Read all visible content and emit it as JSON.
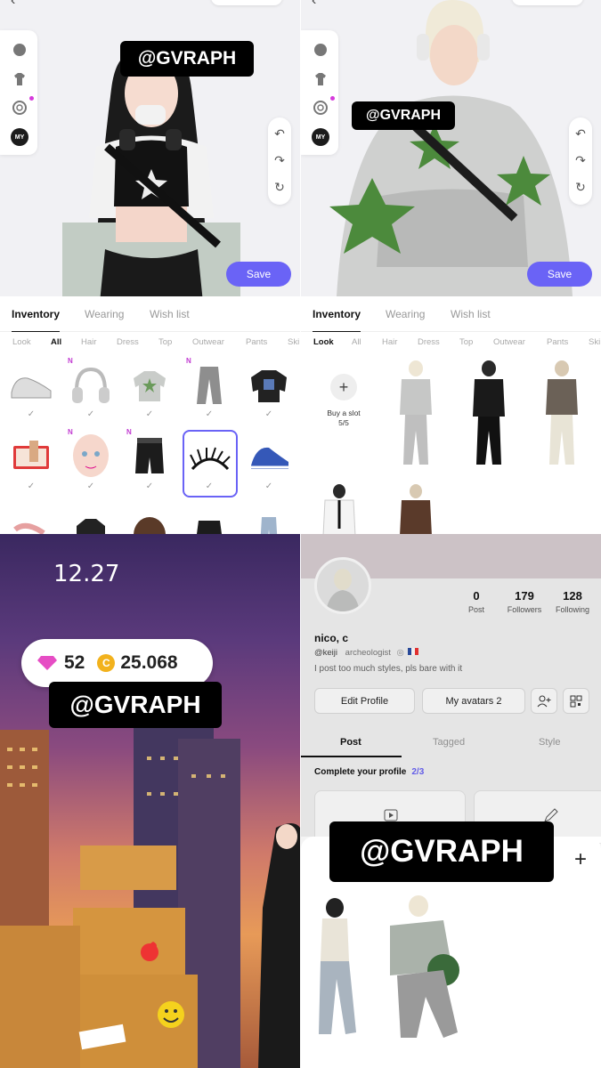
{
  "watermark": "@GVRAPH",
  "editor": {
    "save_label": "Save",
    "rail": [
      "head-icon",
      "shirt-icon",
      "coin-icon",
      "my-icon"
    ],
    "rail_my_label": "MY",
    "tabs": [
      "Inventory",
      "Wearing",
      "Wish list"
    ]
  },
  "left_panel": {
    "categories": [
      "Look",
      "All",
      "Hair",
      "Dress",
      "Top",
      "Outwear",
      "Pants",
      "Ski"
    ],
    "active_category": "All",
    "new_badge": "N",
    "check": "✓"
  },
  "right_panel": {
    "categories": [
      "Look",
      "All",
      "Hair",
      "Dress",
      "Top",
      "Outwear",
      "Pants",
      "Ski"
    ],
    "active_category": "Look",
    "slot_label": "Buy a slot",
    "slot_count": "5/5"
  },
  "game": {
    "time": "12.27",
    "gems": "52",
    "coins": "25.068",
    "coin_symbol": "C"
  },
  "profile": {
    "stats": [
      {
        "num": "0",
        "label": "Post"
      },
      {
        "num": "179",
        "label": "Followers"
      },
      {
        "num": "128",
        "label": "Following"
      }
    ],
    "name": "nico, c",
    "handle": "@keiji",
    "occupation": "archeologist",
    "bio": "I post too much styles, pls bare with it",
    "buttons": [
      "Edit Profile",
      "My avatars 2"
    ],
    "tabs": [
      "Post",
      "Tagged",
      "Style"
    ],
    "complete_label": "Complete your profile",
    "complete_progress": "2/3",
    "plus": "+"
  },
  "colors": {
    "accent": "#6a63f6",
    "new_badge": "#c13ad1"
  }
}
